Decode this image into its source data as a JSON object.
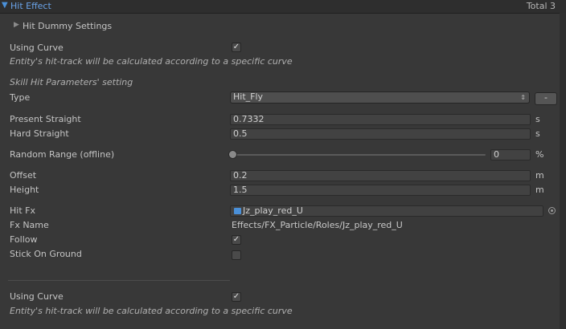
{
  "header": {
    "title": "Hit Effect",
    "total": "Total 3"
  },
  "hit_dummy": {
    "label": "Hit Dummy Settings"
  },
  "curve1": {
    "label": "Using Curve",
    "checked": true,
    "description": "Entity's hit-track will be calculated according to a specific curve"
  },
  "section": {
    "title": "Skill Hit Parameters' setting"
  },
  "type": {
    "label": "Type",
    "value": "Hit_Fly",
    "button": "-"
  },
  "present_straight": {
    "label": "Present Straight",
    "value": "0.7332",
    "unit": "s"
  },
  "hard_straight": {
    "label": "Hard Straight",
    "value": "0.5",
    "unit": "s"
  },
  "random_range": {
    "label": "Random Range (offline)",
    "value": "0",
    "unit": "%",
    "slider_fraction": 0
  },
  "offset": {
    "label": "Offset",
    "value": "0.2",
    "unit": "m"
  },
  "height": {
    "label": "Height",
    "value": "1.5",
    "unit": "m"
  },
  "hit_fx": {
    "label": "Hit Fx",
    "value": "Jz_play_red_U"
  },
  "fx_name": {
    "label": "Fx Name",
    "value": "Effects/FX_Particle/Roles/Jz_play_red_U"
  },
  "follow": {
    "label": "Follow",
    "checked": true
  },
  "stick_on_ground": {
    "label": "Stick On Ground",
    "checked": false
  },
  "curve2": {
    "label": "Using Curve",
    "checked": true,
    "description": "Entity's hit-track will be calculated according to a specific curve"
  },
  "icons": {
    "check": "✓",
    "triangle_right": "▶",
    "triangle_down": "▼",
    "updown": "⇕"
  }
}
